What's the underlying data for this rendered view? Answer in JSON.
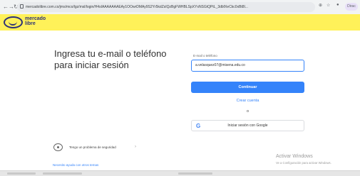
{
  "browser": {
    "url": "mercadolibre.com.co/jms/mco/lgz/msl/login/H4sIAAAAAAAEAy1OOwrDMAy9S2Yr5kdZsIQzBgFWHBLSpXYxNSGtQPtL_3dbfXeCkc0xBt8l...",
    "profile_label": "Dirac"
  },
  "header": {
    "logo_line1": "mercado",
    "logo_line2": "libre"
  },
  "login": {
    "title": "Ingresa tu e-mail o teléfono para iniciar sesión",
    "email_label": "E-mail o teléfono",
    "email_value": "a.velasquez07@misena.edu.co",
    "continue_label": "Continuar",
    "create_account_label": "Crear cuenta",
    "or_label": "o",
    "google_label": "Iniciar sesión con Google"
  },
  "footer": {
    "security_label": "Tengo un problema de seguridad",
    "help_label": "Necesito ayuda con otros temas"
  },
  "windows_watermark": {
    "title": "Activar Windows",
    "subtitle": "Ve a Configuración para activar Windows."
  },
  "colors": {
    "header_yellow": "#fff159",
    "accent_blue": "#3483fa",
    "logo_navy": "#2d3277"
  }
}
